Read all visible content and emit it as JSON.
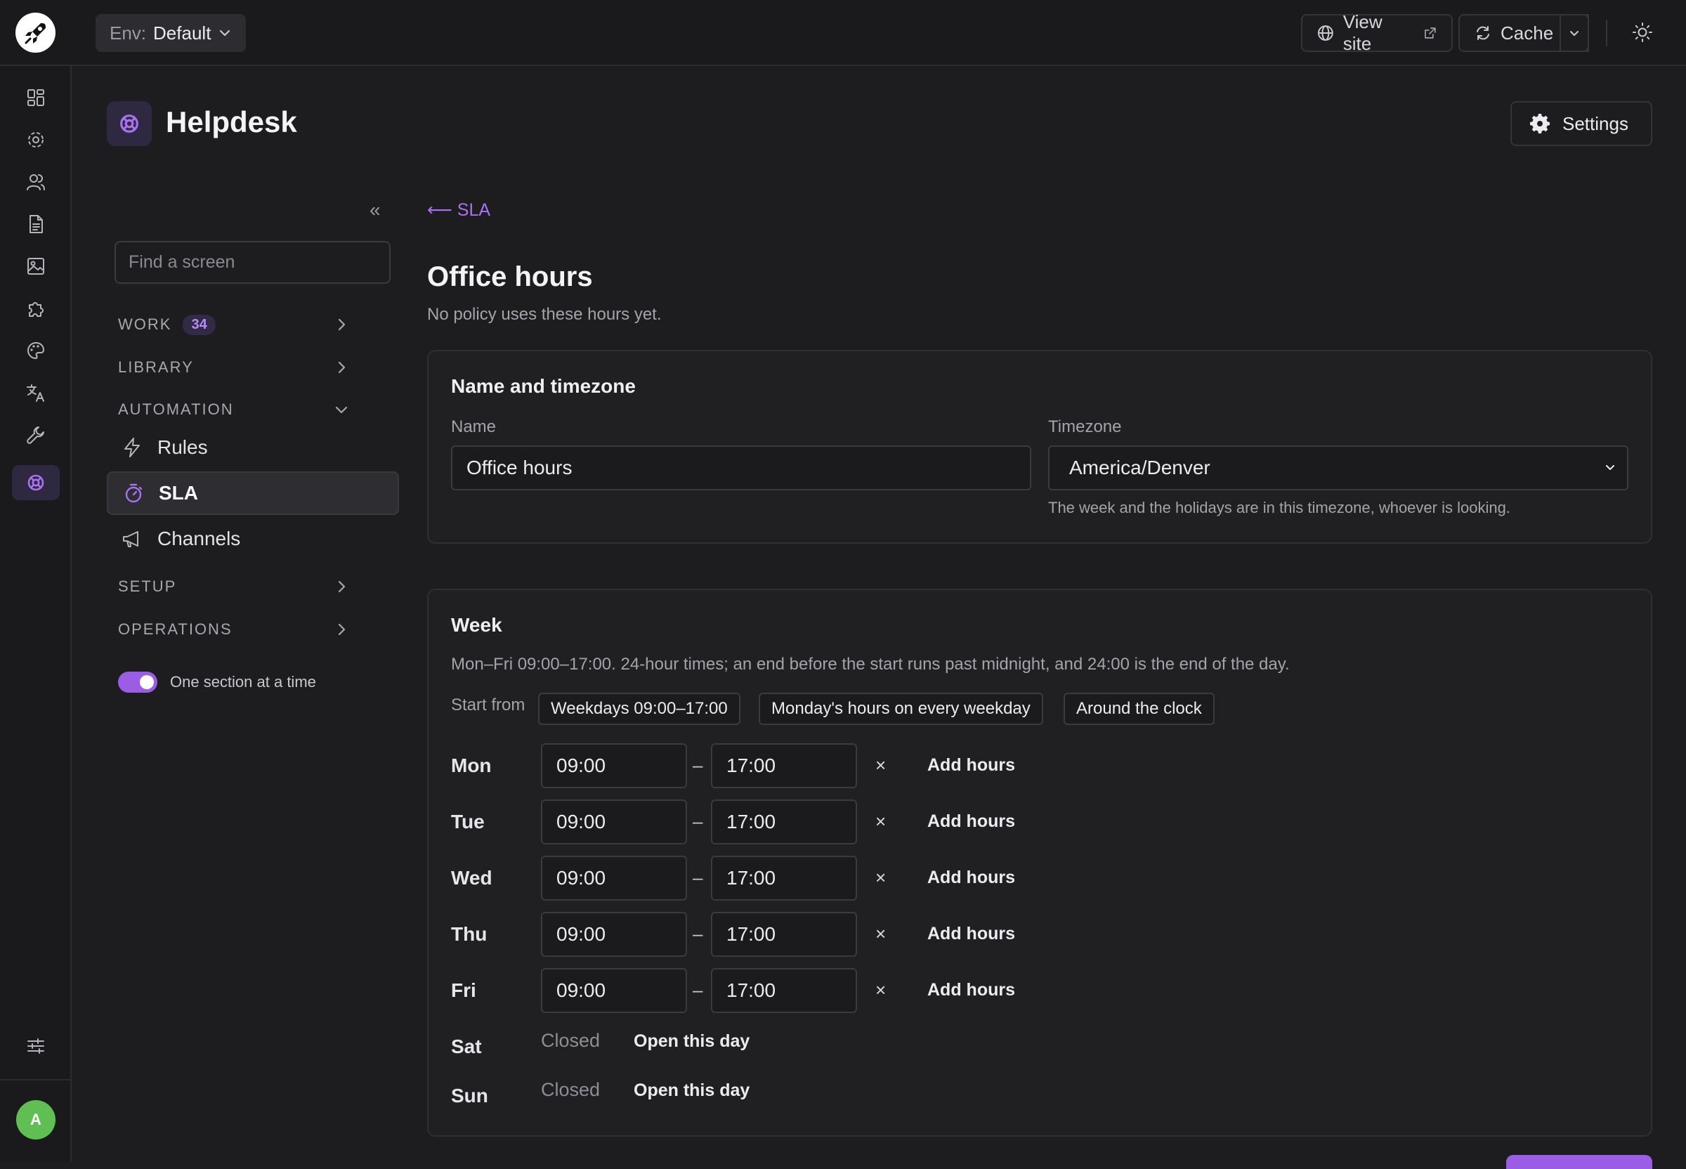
{
  "topbar": {
    "env_label": "Env:",
    "env_value": "Default",
    "view_site": "View site",
    "cache": "Cache"
  },
  "rail": {
    "items": [
      "dashboard-icon",
      "settings-icon",
      "users-icon",
      "document-icon",
      "image-icon",
      "puzzle-icon",
      "palette-icon",
      "translate-icon",
      "wrench-icon",
      "lifebuoy-icon"
    ],
    "active": "lifebuoy-icon",
    "avatar_initial": "A"
  },
  "header": {
    "title": "Helpdesk",
    "settings": "Settings"
  },
  "nav": {
    "search_placeholder": "Find a screen",
    "sections": {
      "work": {
        "label": "WORK",
        "badge": "34"
      },
      "library": {
        "label": "LIBRARY"
      },
      "automation": {
        "label": "AUTOMATION"
      },
      "setup": {
        "label": "SETUP"
      },
      "operations": {
        "label": "OPERATIONS"
      }
    },
    "items": {
      "rules": "Rules",
      "sla": "SLA",
      "channels": "Channels"
    },
    "toggle_label": "One section at a time",
    "toggle_on": true
  },
  "main": {
    "back": "⟵ SLA",
    "title": "Office hours",
    "subtitle": "No policy uses these hours yet.",
    "name_card": {
      "title": "Name and timezone",
      "name_label": "Name",
      "name_value": "Office hours",
      "tz_label": "Timezone",
      "tz_value": "America/Denver",
      "tz_hint": "The week and the holidays are in this timezone, whoever is looking."
    },
    "week": {
      "title": "Week",
      "desc": "Mon–Fri 09:00–17:00. 24-hour times; an end before the start runs past midnight, and 24:00 is the end of the day.",
      "start_from": "Start from",
      "presets": [
        "Weekdays 09:00–17:00",
        "Monday's hours on every weekday",
        "Around the clock"
      ],
      "dash": "–",
      "remove": "×",
      "add": "Add hours",
      "closed": "Closed",
      "open": "Open this day",
      "days": {
        "mon": {
          "label": "Mon",
          "start": "09:00",
          "end": "17:00"
        },
        "tue": {
          "label": "Tue",
          "start": "09:00",
          "end": "17:00"
        },
        "wed": {
          "label": "Wed",
          "start": "09:00",
          "end": "17:00"
        },
        "thu": {
          "label": "Thu",
          "start": "09:00",
          "end": "17:00"
        },
        "fri": {
          "label": "Fri",
          "start": "09:00",
          "end": "17:00"
        },
        "sat": {
          "label": "Sat"
        },
        "sun": {
          "label": "Sun"
        }
      }
    }
  },
  "colors": {
    "accent": "#9b5de5",
    "link": "#a872f0",
    "background": "#1d1d20",
    "avatar": "#5fbf53"
  }
}
